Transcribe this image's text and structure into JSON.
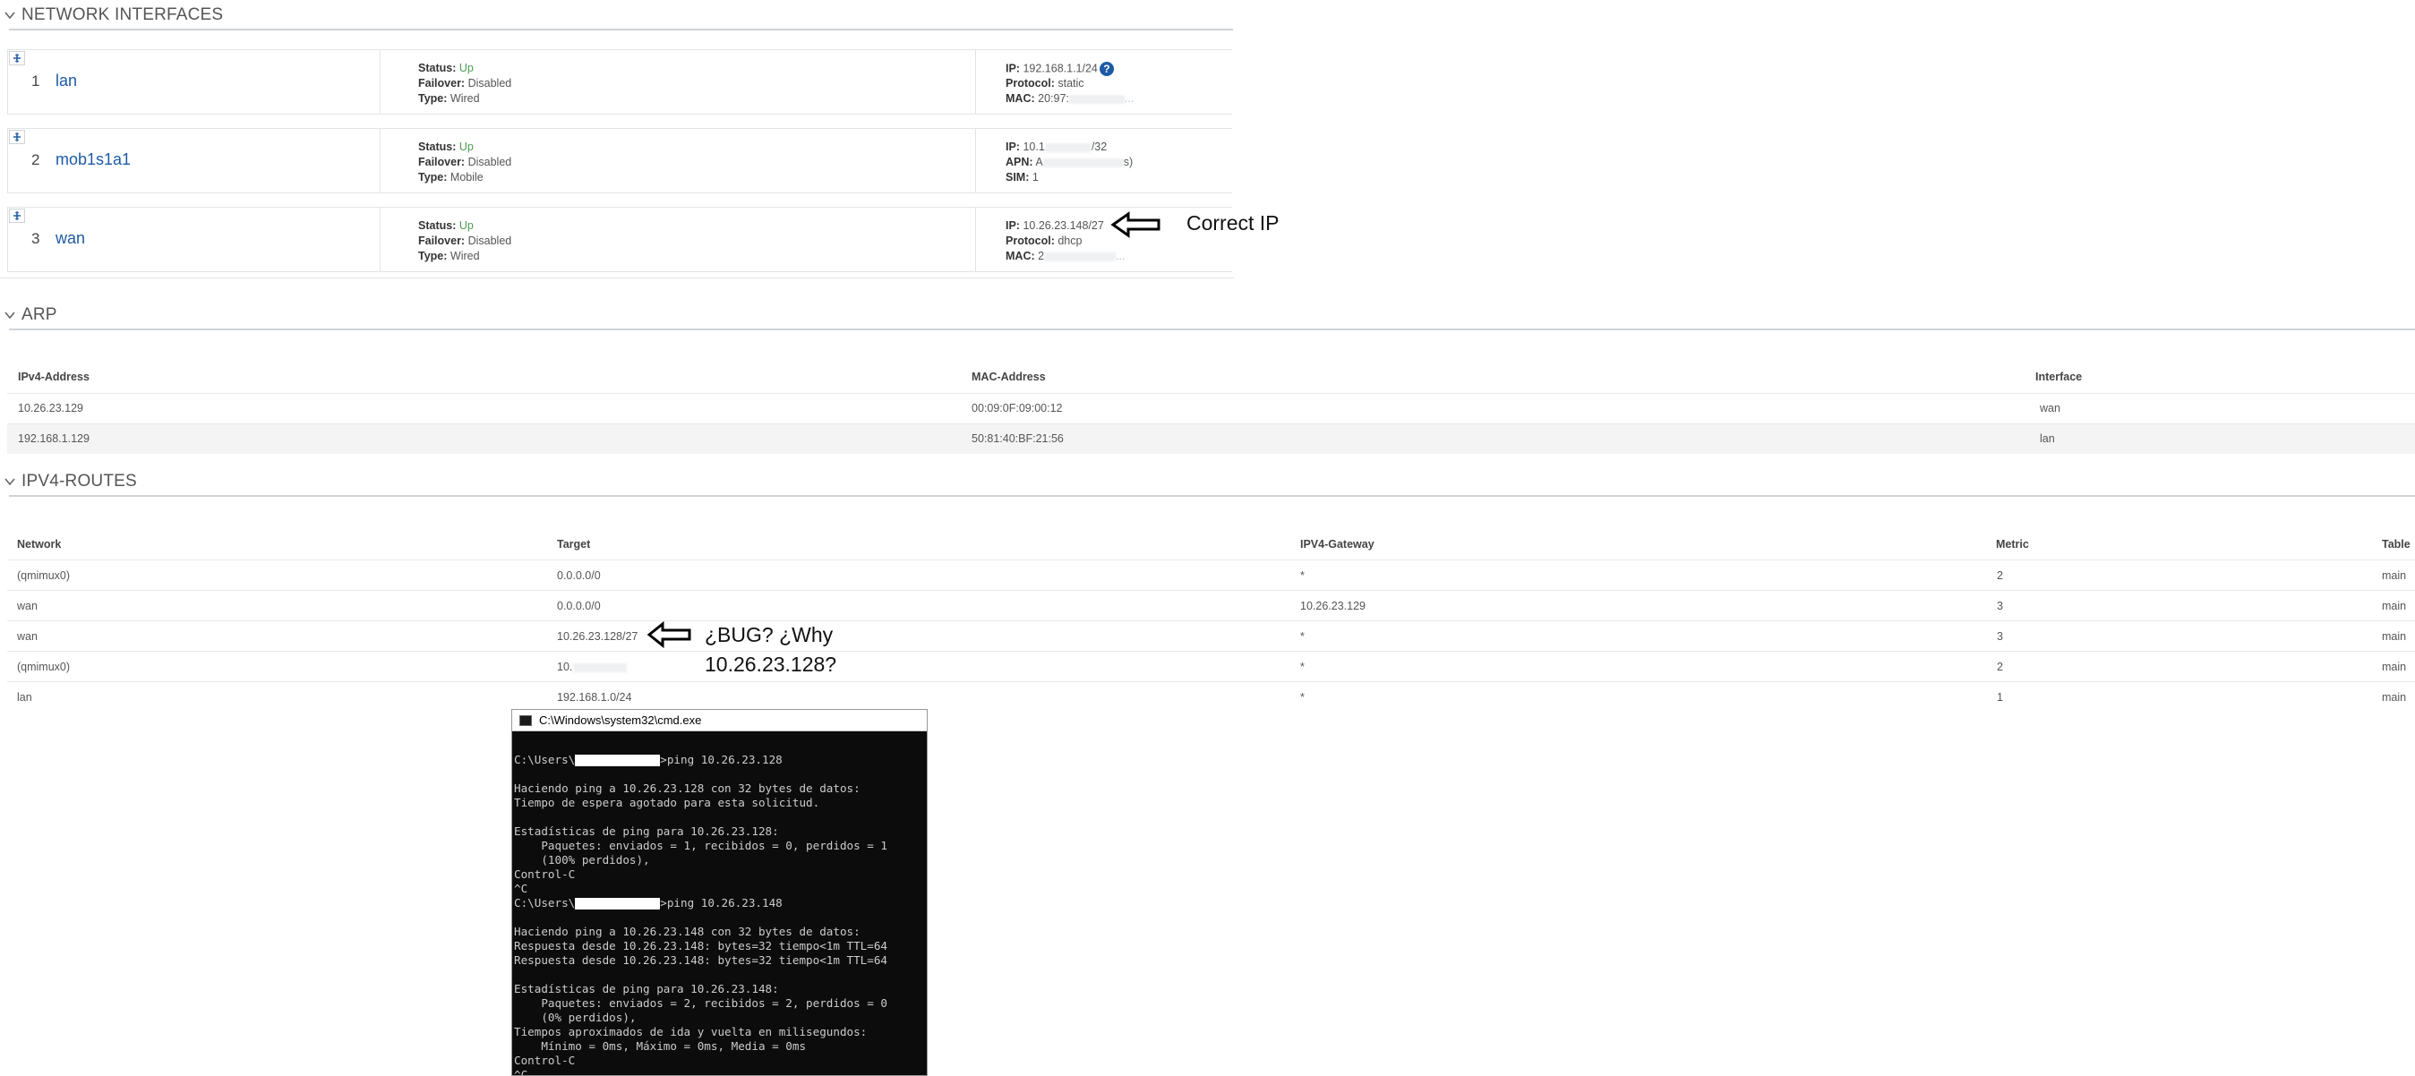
{
  "sections": {
    "network_interfaces": "NETWORK INTERFACES",
    "arp": "ARP",
    "routes": "IPV4-ROUTES"
  },
  "interfaces": [
    {
      "num": "1",
      "name": "lan",
      "status_label": "Status:",
      "status": "Up",
      "failover_label": "Failover:",
      "failover": "Disabled",
      "type_label": "Type:",
      "type": "Wired",
      "k1": "IP:",
      "v1": "192.168.1.1/24",
      "k2": "Protocol:",
      "v2": "static",
      "k3": "MAC:",
      "v3": "20:97:"
    },
    {
      "num": "2",
      "name": "mob1s1a1",
      "status_label": "Status:",
      "status": "Up",
      "failover_label": "Failover:",
      "failover": "Disabled",
      "type_label": "Type:",
      "type": "Mobile",
      "k1": "IP:",
      "v1": "10.1",
      "k2": "APN:",
      "v2": "A",
      "k3": "SIM:",
      "v3": "1"
    },
    {
      "num": "3",
      "name": "wan",
      "status_label": "Status:",
      "status": "Up",
      "failover_label": "Failover:",
      "failover": "Disabled",
      "type_label": "Type:",
      "type": "Wired",
      "k1": "IP:",
      "v1": "10.26.23.148/27",
      "k2": "Protocol:",
      "v2": "dhcp",
      "k3": "MAC:",
      "v3": "2"
    }
  ],
  "v1_tail": "/32",
  "v2_tail": "s)",
  "v3_tail_lan": "...",
  "v3_tail_wan": "...",
  "help_glyph": "?",
  "arp": {
    "headers": [
      "IPv4-Address",
      "MAC-Address",
      "Interface"
    ],
    "rows": [
      [
        "10.26.23.129",
        "00:09:0F:09:00:12",
        "wan"
      ],
      [
        "192.168.1.129",
        "50:81:40:BF:21:56",
        "lan"
      ]
    ]
  },
  "routes": {
    "headers": [
      "Network",
      "Target",
      "IPV4-Gateway",
      "Metric",
      "Table"
    ],
    "rows": [
      [
        "(qmimux0)",
        "0.0.0.0/0",
        "*",
        "2",
        "main"
      ],
      [
        "wan",
        "0.0.0.0/0",
        "10.26.23.129",
        "3",
        "main"
      ],
      [
        "wan",
        "10.26.23.128/27",
        "*",
        "3",
        "main"
      ],
      [
        "(qmimux0)",
        "10.",
        "*",
        "2",
        "main"
      ],
      [
        "lan",
        "192.168.1.0/24",
        "*",
        "1",
        "main"
      ]
    ]
  },
  "annotations": {
    "correct_ip": "Correct IP",
    "bug_line1": "¿BUG? ¿Why",
    "bug_line2": "10.26.23.128?"
  },
  "cmd": {
    "title": "C:\\Windows\\system32\\cmd.exe",
    "lines": [
      "",
      "C:\\Users\\",
      "",
      "Haciendo ping a 10.26.23.128 con 32 bytes de datos:",
      "Tiempo de espera agotado para esta solicitud.",
      "",
      "Estadísticas de ping para 10.26.23.128:",
      "    Paquetes: enviados = 1, recibidos = 0, perdidos = 1",
      "    (100% perdidos),",
      "Control-C",
      "^C",
      "C:\\Users\\",
      "",
      "Haciendo ping a 10.26.23.148 con 32 bytes de datos:",
      "Respuesta desde 10.26.23.148: bytes=32 tiempo<1m TTL=64",
      "Respuesta desde 10.26.23.148: bytes=32 tiempo<1m TTL=64",
      "",
      "Estadísticas de ping para 10.26.23.148:",
      "    Paquetes: enviados = 2, recibidos = 2, perdidos = 0",
      "    (0% perdidos),",
      "Tiempos aproximados de ida y vuelta en milisegundos:",
      "    Mínimo = 0ms, Máximo = 0ms, Media = 0ms",
      "Control-C",
      "^C"
    ],
    "ping_cmd_1": "ping 10.26.23.128",
    "ping_cmd_2": "ping 10.26.23.148"
  }
}
